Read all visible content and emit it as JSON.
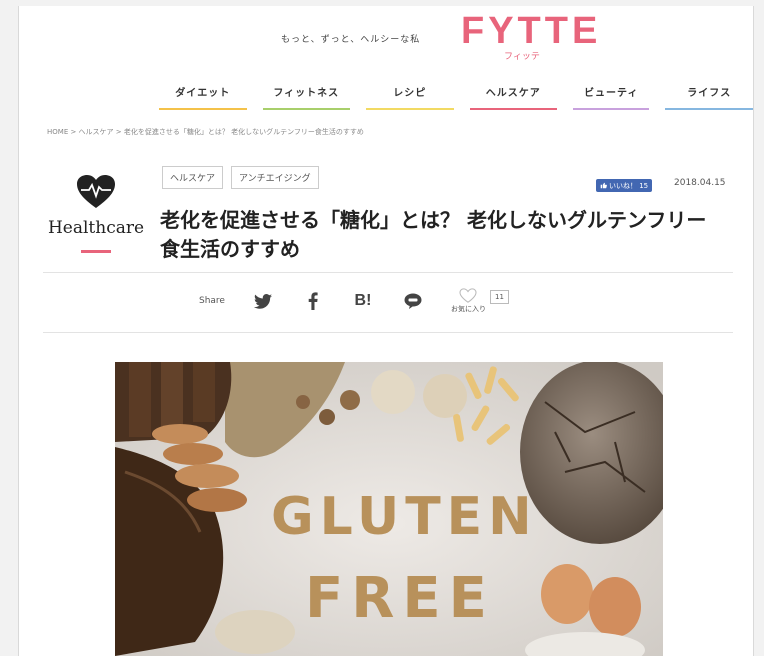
{
  "header": {
    "tagline": "もっと、ずっと、ヘルシーな私",
    "logo": "FYTTE",
    "logo_sub": "フィッテ"
  },
  "nav": {
    "items": [
      {
        "label": "ダイエット",
        "color": "#f4c24a"
      },
      {
        "label": "フィットネス",
        "color": "#a8cf6b"
      },
      {
        "label": "レシピ",
        "color": "#f2da63"
      },
      {
        "label": "ヘルスケア",
        "color": "#e8647b"
      },
      {
        "label": "ビューティ",
        "color": "#c8a1dd"
      },
      {
        "label": "ライフス",
        "color": "#86b7e0"
      }
    ]
  },
  "breadcrumb": "HOME  >  ヘルスケア  >  老化を促進させる「糖化」とは？ 老化しないグルテンフリー食生活のすすめ",
  "category": {
    "name": "Healthcare",
    "accent": "#e8647b"
  },
  "tags": [
    "ヘルスケア",
    "アンチエイジング"
  ],
  "like": {
    "label": "いいね！ 15"
  },
  "date": "2018.04.15",
  "title_line1": "老化を促進させる「糖化」とは？ 老化しないグルテンフリー",
  "title_line2": "食生活のすすめ",
  "share": {
    "label": "Share",
    "hatena": "B!",
    "favorite_label": "お気に入り",
    "favorite_count": "11"
  },
  "hero": {
    "line1": "GLUTEN",
    "line2": "FREE"
  }
}
